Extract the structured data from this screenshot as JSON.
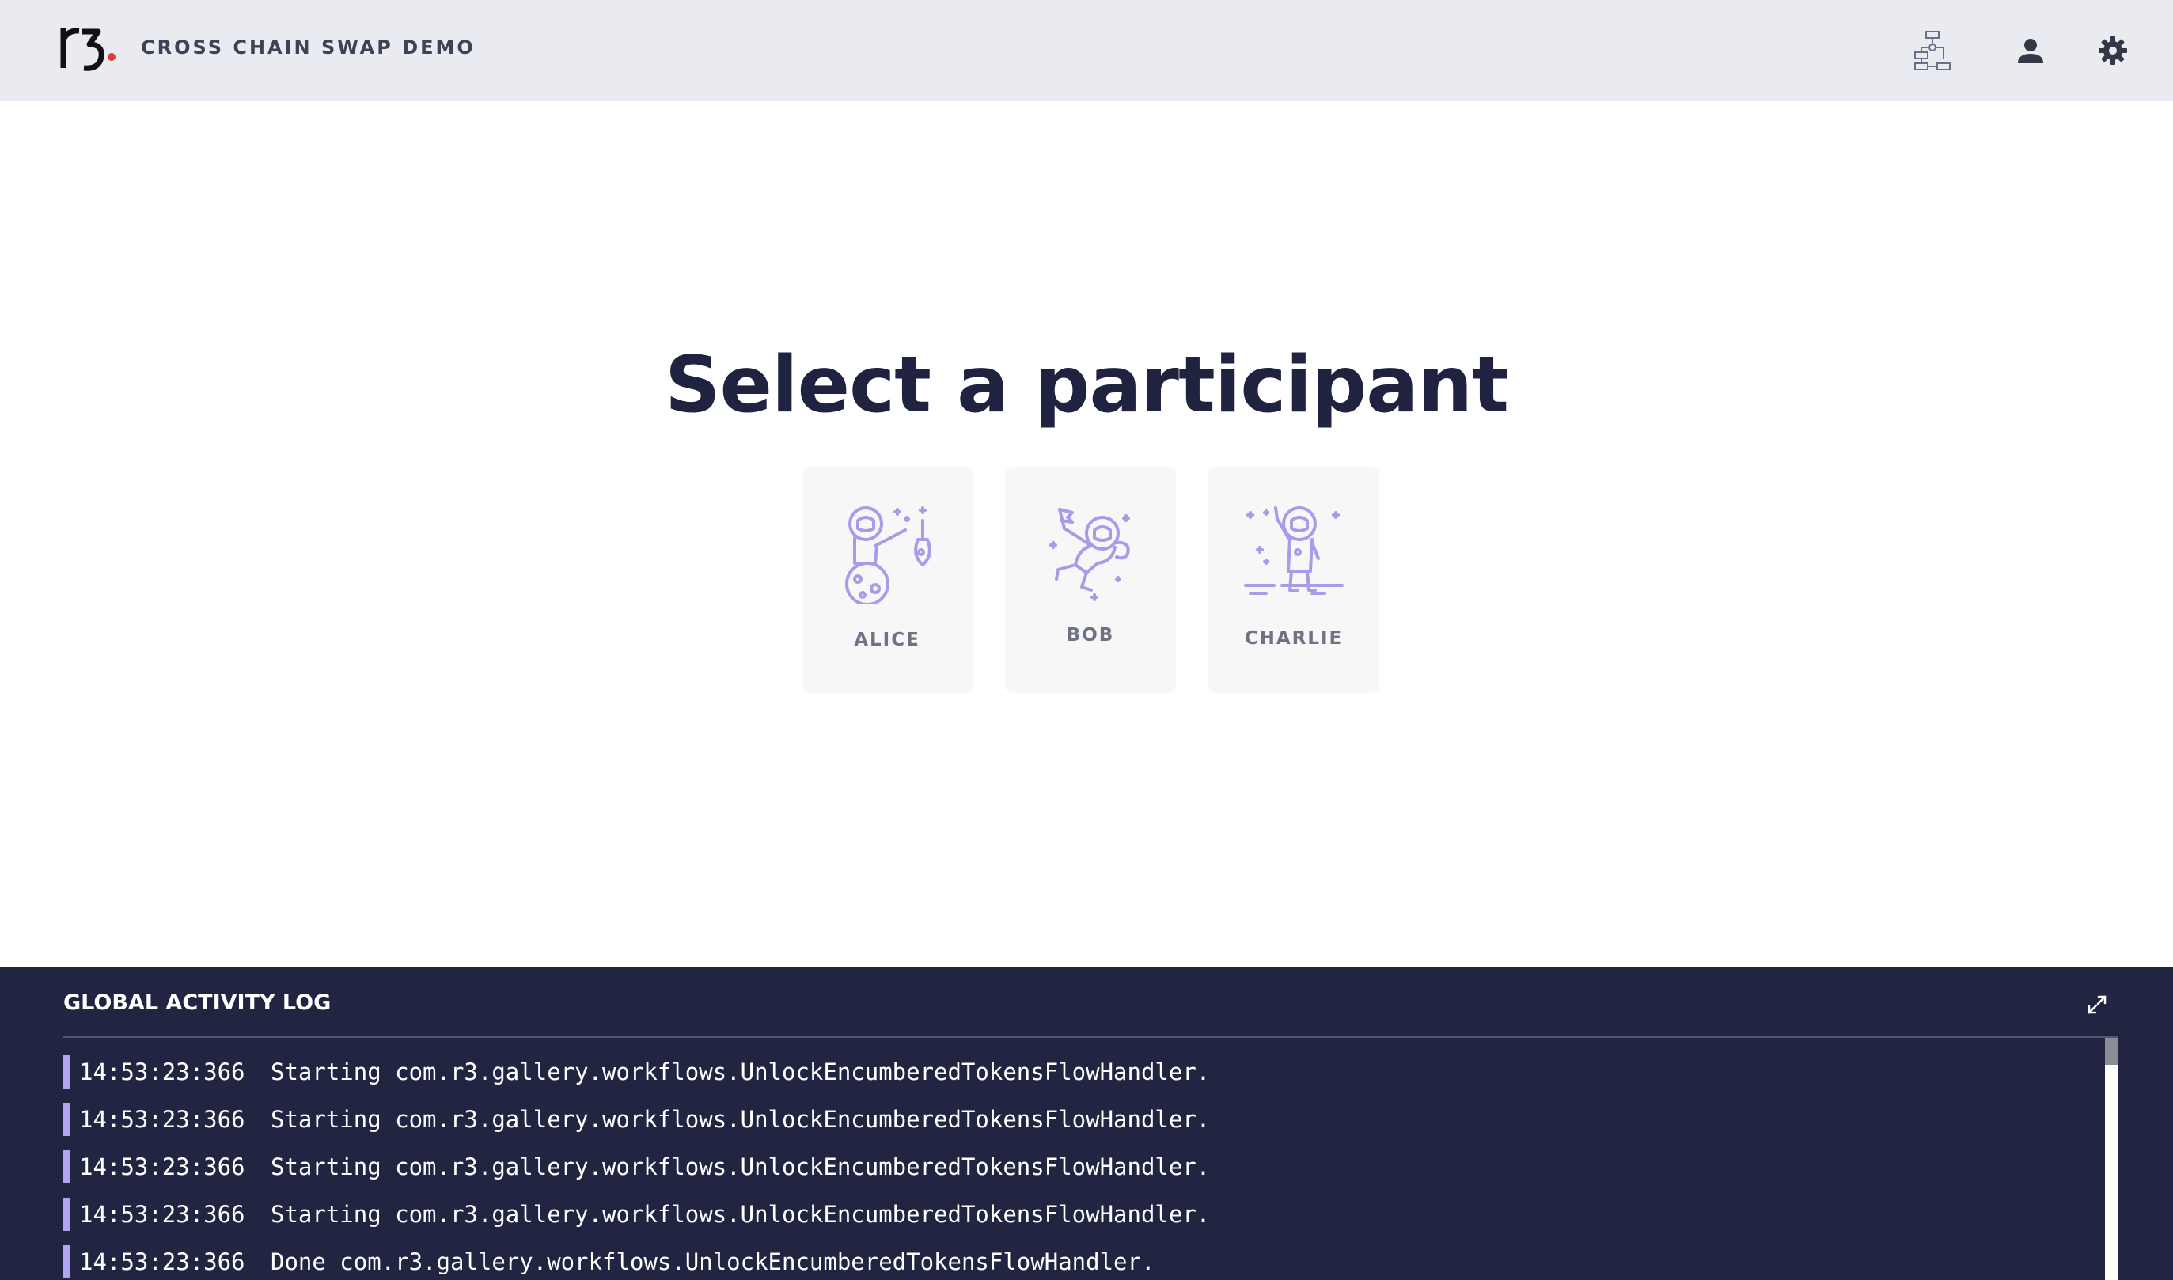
{
  "header": {
    "logo_text": "r3.",
    "app_title": "CROSS CHAIN SWAP DEMO",
    "icons": {
      "network": "network-diagram-icon",
      "user": "user-icon",
      "settings": "gear-icon"
    }
  },
  "main": {
    "heading": "Select a participant",
    "participants": [
      {
        "name": "ALICE",
        "icon": "astronaut-fishing-icon"
      },
      {
        "name": "BOB",
        "icon": "astronaut-floating-icon"
      },
      {
        "name": "CHARLIE",
        "icon": "astronaut-waving-icon"
      }
    ]
  },
  "activity_log": {
    "title": "GLOBAL ACTIVITY LOG",
    "expand_icon": "expand-icon",
    "entries": [
      {
        "time": "14:53:23:366",
        "message": "Starting com.r3.gallery.workflows.UnlockEncumberedTokensFlowHandler."
      },
      {
        "time": "14:53:23:366",
        "message": "Starting com.r3.gallery.workflows.UnlockEncumberedTokensFlowHandler."
      },
      {
        "time": "14:53:23:366",
        "message": "Starting com.r3.gallery.workflows.UnlockEncumberedTokensFlowHandler."
      },
      {
        "time": "14:53:23:366",
        "message": "Starting com.r3.gallery.workflows.UnlockEncumberedTokensFlowHandler."
      },
      {
        "time": "14:53:23:366",
        "message": "Done com.r3.gallery.workflows.UnlockEncumberedTokensFlowHandler."
      }
    ]
  },
  "colors": {
    "header_bg": "#e9ebf0",
    "heading": "#1f2340",
    "accent_purple": "#b1a6f0",
    "logo_dot": "#e03b3b",
    "log_bg": "#212542"
  }
}
